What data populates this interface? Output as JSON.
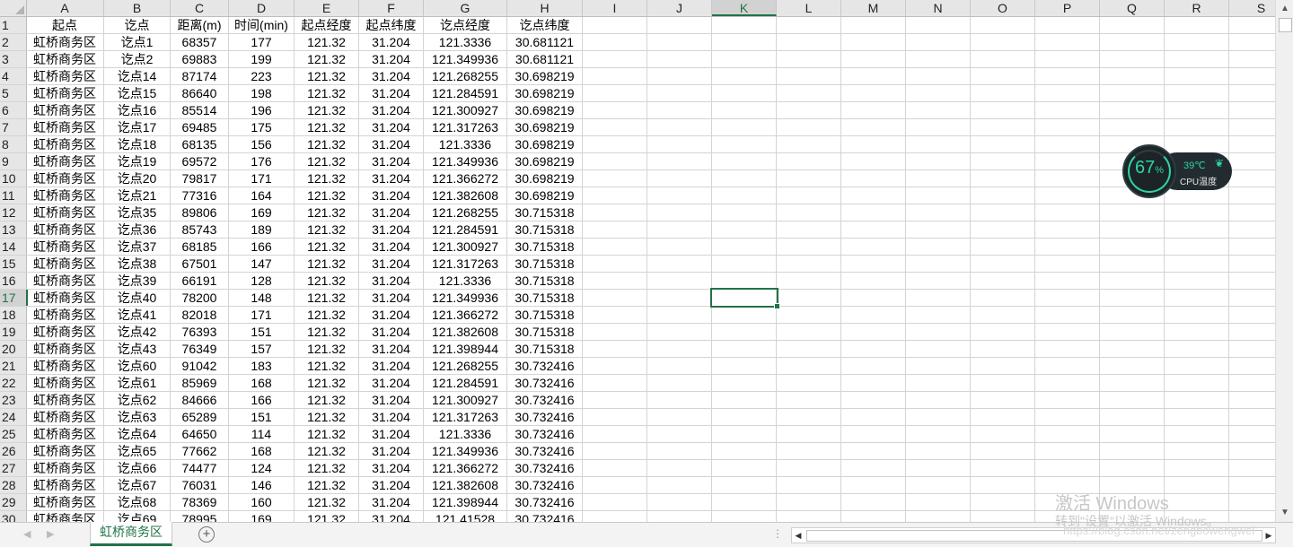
{
  "columns": [
    "A",
    "B",
    "C",
    "D",
    "E",
    "F",
    "G",
    "H",
    "I",
    "J",
    "K",
    "L",
    "M",
    "N",
    "O",
    "P",
    "Q",
    "R",
    "S"
  ],
  "selected_column": "K",
  "selected_row": "17",
  "header_row": [
    "起点",
    "讫点",
    "距离(m)",
    "时间(min)",
    "起点经度",
    "起点纬度",
    "讫点经度",
    "讫点纬度"
  ],
  "rows": [
    [
      "2",
      "虹桥商务区",
      "讫点1",
      "68357",
      "177",
      "121.32",
      "31.204",
      "121.3336",
      "30.681121"
    ],
    [
      "3",
      "虹桥商务区",
      "讫点2",
      "69883",
      "199",
      "121.32",
      "31.204",
      "121.349936",
      "30.681121"
    ],
    [
      "4",
      "虹桥商务区",
      "讫点14",
      "87174",
      "223",
      "121.32",
      "31.204",
      "121.268255",
      "30.698219"
    ],
    [
      "5",
      "虹桥商务区",
      "讫点15",
      "86640",
      "198",
      "121.32",
      "31.204",
      "121.284591",
      "30.698219"
    ],
    [
      "6",
      "虹桥商务区",
      "讫点16",
      "85514",
      "196",
      "121.32",
      "31.204",
      "121.300927",
      "30.698219"
    ],
    [
      "7",
      "虹桥商务区",
      "讫点17",
      "69485",
      "175",
      "121.32",
      "31.204",
      "121.317263",
      "30.698219"
    ],
    [
      "8",
      "虹桥商务区",
      "讫点18",
      "68135",
      "156",
      "121.32",
      "31.204",
      "121.3336",
      "30.698219"
    ],
    [
      "9",
      "虹桥商务区",
      "讫点19",
      "69572",
      "176",
      "121.32",
      "31.204",
      "121.349936",
      "30.698219"
    ],
    [
      "10",
      "虹桥商务区",
      "讫点20",
      "79817",
      "171",
      "121.32",
      "31.204",
      "121.366272",
      "30.698219"
    ],
    [
      "11",
      "虹桥商务区",
      "讫点21",
      "77316",
      "164",
      "121.32",
      "31.204",
      "121.382608",
      "30.698219"
    ],
    [
      "12",
      "虹桥商务区",
      "讫点35",
      "89806",
      "169",
      "121.32",
      "31.204",
      "121.268255",
      "30.715318"
    ],
    [
      "13",
      "虹桥商务区",
      "讫点36",
      "85743",
      "189",
      "121.32",
      "31.204",
      "121.284591",
      "30.715318"
    ],
    [
      "14",
      "虹桥商务区",
      "讫点37",
      "68185",
      "166",
      "121.32",
      "31.204",
      "121.300927",
      "30.715318"
    ],
    [
      "15",
      "虹桥商务区",
      "讫点38",
      "67501",
      "147",
      "121.32",
      "31.204",
      "121.317263",
      "30.715318"
    ],
    [
      "16",
      "虹桥商务区",
      "讫点39",
      "66191",
      "128",
      "121.32",
      "31.204",
      "121.3336",
      "30.715318"
    ],
    [
      "17",
      "虹桥商务区",
      "讫点40",
      "78200",
      "148",
      "121.32",
      "31.204",
      "121.349936",
      "30.715318"
    ],
    [
      "18",
      "虹桥商务区",
      "讫点41",
      "82018",
      "171",
      "121.32",
      "31.204",
      "121.366272",
      "30.715318"
    ],
    [
      "19",
      "虹桥商务区",
      "讫点42",
      "76393",
      "151",
      "121.32",
      "31.204",
      "121.382608",
      "30.715318"
    ],
    [
      "20",
      "虹桥商务区",
      "讫点43",
      "76349",
      "157",
      "121.32",
      "31.204",
      "121.398944",
      "30.715318"
    ],
    [
      "21",
      "虹桥商务区",
      "讫点60",
      "91042",
      "183",
      "121.32",
      "31.204",
      "121.268255",
      "30.732416"
    ],
    [
      "22",
      "虹桥商务区",
      "讫点61",
      "85969",
      "168",
      "121.32",
      "31.204",
      "121.284591",
      "30.732416"
    ],
    [
      "23",
      "虹桥商务区",
      "讫点62",
      "84666",
      "166",
      "121.32",
      "31.204",
      "121.300927",
      "30.732416"
    ],
    [
      "24",
      "虹桥商务区",
      "讫点63",
      "65289",
      "151",
      "121.32",
      "31.204",
      "121.317263",
      "30.732416"
    ],
    [
      "25",
      "虹桥商务区",
      "讫点64",
      "64650",
      "114",
      "121.32",
      "31.204",
      "121.3336",
      "30.732416"
    ],
    [
      "26",
      "虹桥商务区",
      "讫点65",
      "77662",
      "168",
      "121.32",
      "31.204",
      "121.349936",
      "30.732416"
    ],
    [
      "27",
      "虹桥商务区",
      "讫点66",
      "74477",
      "124",
      "121.32",
      "31.204",
      "121.366272",
      "30.732416"
    ],
    [
      "28",
      "虹桥商务区",
      "讫点67",
      "76031",
      "146",
      "121.32",
      "31.204",
      "121.382608",
      "30.732416"
    ],
    [
      "29",
      "虹桥商务区",
      "讫点68",
      "78369",
      "160",
      "121.32",
      "31.204",
      "121.398944",
      "30.732416"
    ],
    [
      "30",
      "虹桥商务区",
      "讫点69",
      "78995",
      "169",
      "121.32",
      "31.204",
      "121.41528",
      "30.732416"
    ]
  ],
  "sheet_tab": "虹桥商务区",
  "cpu_widget": {
    "percent": "67",
    "percent_unit": "%",
    "temperature": "39℃",
    "label": "CPU温度"
  },
  "watermark": {
    "line1": "激活 Windows",
    "line2": "转到\"设置\"以激活 Windows。",
    "url": "https://blog.csdn.net/zengbowengwei"
  },
  "colors": {
    "accent": "#217346"
  }
}
